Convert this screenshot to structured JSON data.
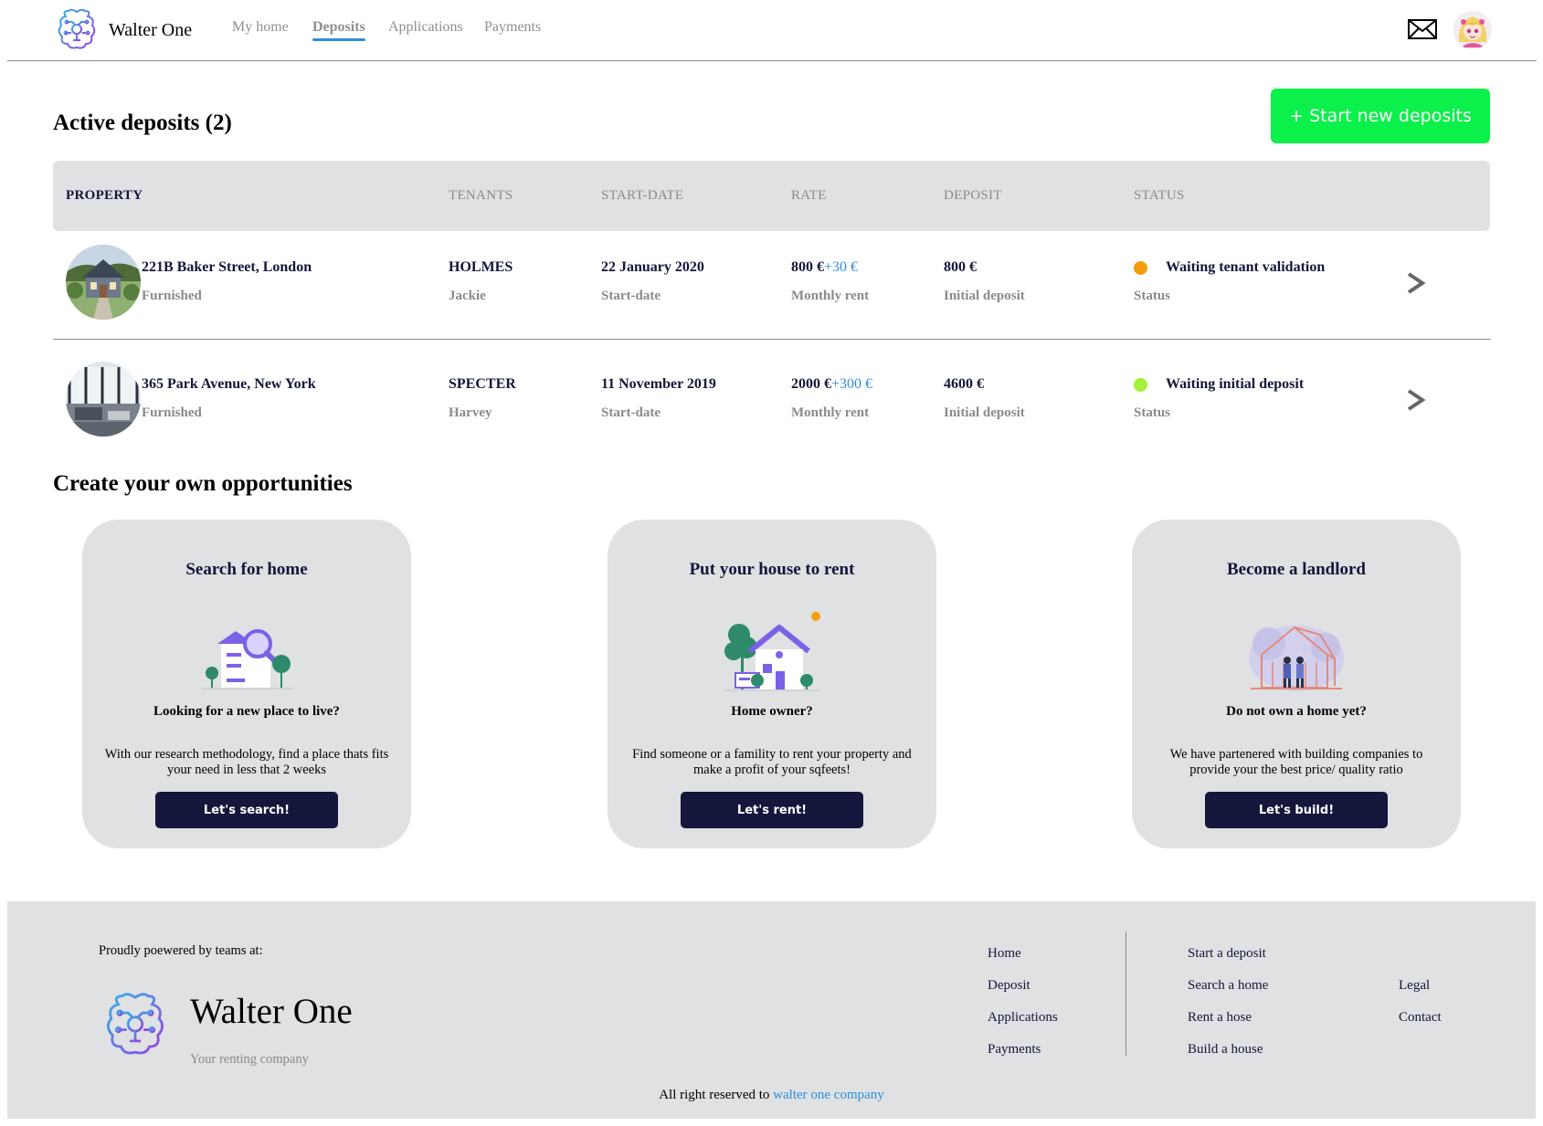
{
  "header": {
    "brand": "Walter One",
    "nav": [
      "My home",
      "Deposits",
      "Applications",
      "Payments"
    ],
    "active_nav": "Deposits"
  },
  "deposits": {
    "title": "Active deposits (2)",
    "start_button": "+ Start new deposits",
    "columns": [
      "PROPERTY",
      "TENANTS",
      "START-DATE",
      "RATE",
      "DEPOSIT",
      "STATUS"
    ],
    "rows": [
      {
        "address": "221B Baker Street, London",
        "furnishing": "Furnished",
        "tenant_last": "HOLMES",
        "tenant_first": "Jackie",
        "start_date": "22 January 2020",
        "start_label": "Start-date",
        "rent": "800 €",
        "rent_extra": "+30 €",
        "rent_label": "Monthly rent",
        "deposit": "800 €",
        "deposit_label": "Initial deposit",
        "status": "Waiting tenant validation",
        "status_label": "Status",
        "status_color": "#f59d0c"
      },
      {
        "address": "365 Park Avenue, New York",
        "furnishing": "Furnished",
        "tenant_last": "SPECTER",
        "tenant_first": "Harvey",
        "start_date": "11 November 2019",
        "start_label": "Start-date",
        "rent": "2000 €",
        "rent_extra": "+300 €",
        "rent_label": "Monthly rent",
        "deposit": "4600 €",
        "deposit_label": "Initial deposit",
        "status": "Waiting initial deposit",
        "status_label": "Status",
        "status_color": "#a4f03a"
      }
    ]
  },
  "opportunities": {
    "title": "Create your own opportunities",
    "cards": [
      {
        "title": "Search for home",
        "question": "Looking for a new place to live?",
        "text": "With our research methodology, find a place thats fits your need in less that 2 weeks",
        "button": "Let's search!",
        "icon": "house-search-icon"
      },
      {
        "title": "Put your house to rent",
        "question": "Home owner?",
        "text": "Find someone or a famility to rent your property and make a profit of your sqfeets!",
        "button": "Let's rent!",
        "icon": "house-rent-icon"
      },
      {
        "title": "Become a landlord",
        "question": "Do not own a home yet?",
        "text": "We have partenered with building companies to provide your the best price/ quality ratio",
        "button": "Let's build!",
        "icon": "house-build-icon"
      }
    ]
  },
  "footer": {
    "powered": "Proudly poewered by teams at:",
    "brand": "Walter One",
    "tagline": "Your renting company",
    "links_col1": [
      "Home",
      "Deposit",
      "Applications",
      "Payments"
    ],
    "links_col2": [
      "Start a deposit",
      "Search a home",
      "Rent a hose",
      "Build a house"
    ],
    "links_col3": [
      "Legal",
      "Contact"
    ],
    "copyright": "All right reserved to",
    "copyright_link": "walter one company"
  },
  "colors": {
    "accent_green": "#0bf04a",
    "navy": "#14163b",
    "link_blue": "#2f8ee0",
    "panel_grey": "#dfe1e2"
  }
}
